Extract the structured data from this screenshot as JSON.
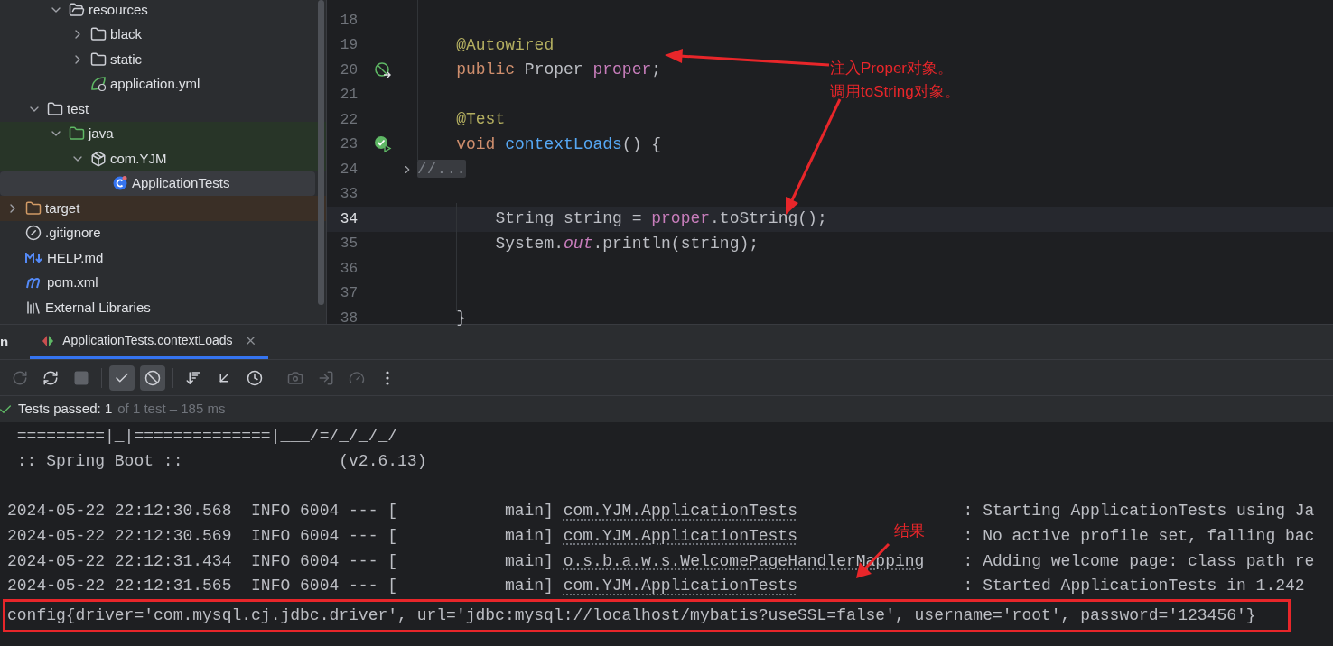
{
  "project_tree": [
    {
      "children": [
        {
          "children": [
            {
              "label": "resources",
              "kind": "resources",
              "expanded": true,
              "selected": false,
              "children": [
                {
                  "label": "black",
                  "kind": "folder",
                  "expanded": false,
                  "selected": false
                },
                {
                  "label": "static",
                  "kind": "folder",
                  "expanded": false,
                  "selected": false
                },
                {
                  "label": "application.yml",
                  "kind": "spring",
                  "selected": false
                }
              ]
            }
          ]
        },
        {
          "label": "test",
          "kind": "folder",
          "expanded": true,
          "selected": false,
          "children": [
            {
              "label": "java",
              "kind": "test-folder",
              "expanded": true,
              "selected": false,
              "children": [
                {
                  "label": "com.YJM",
                  "kind": "test-package",
                  "expanded": true,
                  "selected": false,
                  "children": [
                    {
                      "label": "ApplicationTests",
                      "kind": "test-class",
                      "selected": true
                    }
                  ]
                }
              ]
            }
          ]
        }
      ]
    },
    {
      "label": "target",
      "kind": "excluded-folder",
      "expanded": false,
      "selected": false
    },
    {
      "label": ".gitignore",
      "kind": "ignore",
      "selected": false
    },
    {
      "label": "HELP.md",
      "kind": "markdown",
      "selected": false
    },
    {
      "label": "pom.xml",
      "kind": "maven",
      "selected": false
    },
    {
      "label": "External Libraries",
      "kind": "library",
      "selected": false
    }
  ],
  "editor": {
    "lines": [
      {
        "number": "18",
        "current": false
      },
      {
        "number": "19",
        "current": false,
        "tokens": [
          {
            "text": "    @Autowired",
            "kind": "annotation"
          }
        ]
      },
      {
        "number": "20",
        "current": false,
        "kind": "bean",
        "tokens": [
          {
            "text": "    public ",
            "kind": "keyword"
          },
          {
            "text": "Proper ",
            "kind": "plain"
          },
          {
            "text": "proper",
            "kind": "field"
          },
          {
            "text": ";",
            "kind": "plain"
          }
        ]
      },
      {
        "number": "21",
        "current": false
      },
      {
        "number": "22",
        "current": false,
        "tokens": [
          {
            "text": "    @Test",
            "kind": "annotation"
          }
        ]
      },
      {
        "number": "23",
        "current": false,
        "kind": "run-passed",
        "tokens": [
          {
            "text": "    void ",
            "kind": "keyword"
          },
          {
            "text": "contextLoads",
            "kind": "method"
          },
          {
            "text": "() {",
            "kind": "plain"
          }
        ]
      },
      {
        "number": "24",
        "current": false,
        "kind": "fold",
        "tokens": [
          {
            "text": "//...",
            "kind": "folded"
          }
        ]
      },
      {
        "number": "33",
        "current": false
      },
      {
        "number": "34",
        "current": true,
        "tokens": [
          {
            "text": "        String string = ",
            "kind": "plain"
          },
          {
            "text": "proper",
            "kind": "field"
          },
          {
            "text": ".toString();",
            "kind": "plain"
          }
        ]
      },
      {
        "number": "35",
        "current": false,
        "tokens": [
          {
            "text": "        System.",
            "kind": "plain"
          },
          {
            "text": "out",
            "kind": "static-field"
          },
          {
            "text": ".println(string);",
            "kind": "plain"
          }
        ]
      },
      {
        "number": "36",
        "current": false
      },
      {
        "number": "37",
        "current": false
      },
      {
        "number": "38",
        "current": false,
        "tokens": [
          {
            "text": "    }",
            "kind": "plain"
          }
        ]
      }
    ]
  },
  "run_panel": {
    "tool_window_label": "n",
    "tabs": [
      {
        "label": "ApplicationTests.contextLoads",
        "selected": true
      }
    ],
    "toolbar": [
      {
        "kind": "rerun",
        "on": false,
        "disabled": true
      },
      {
        "kind": "rerun-failed",
        "on": false,
        "disabled": false
      },
      {
        "kind": "stop",
        "on": false,
        "disabled": true
      },
      {
        "kind": "show-passed",
        "on": true,
        "disabled": false
      },
      {
        "kind": "show-ignored",
        "on": true,
        "disabled": false
      },
      {
        "kind": "sort",
        "on": false,
        "disabled": false
      },
      {
        "kind": "collapse",
        "on": false,
        "disabled": false
      },
      {
        "kind": "duration",
        "on": false,
        "disabled": false
      },
      {
        "kind": "screenshot",
        "on": false,
        "disabled": true
      },
      {
        "kind": "import",
        "on": false,
        "disabled": true
      },
      {
        "kind": "profile",
        "on": false,
        "disabled": true
      },
      {
        "kind": "more",
        "on": false,
        "disabled": false
      }
    ],
    "status": {
      "passed": "Tests passed: 1",
      "detail": "of 1 test – 185 ms"
    },
    "console": [
      {
        "kind": "banner",
        "text": " =========|_|==============|___/=/_/_/_/"
      },
      {
        "kind": "banner",
        "text": " :: Spring Boot ::                (v2.6.13)"
      },
      {
        "kind": "blank"
      },
      {
        "kind": "log",
        "prefix": "2024-05-22 22:12:30.568  INFO 6004 --- [           main]",
        "logger": "com.YJM.ApplicationTests",
        "message": ": Starting ApplicationTests using Ja"
      },
      {
        "kind": "log",
        "prefix": "2024-05-22 22:12:30.569  INFO 6004 --- [           main]",
        "logger": "com.YJM.ApplicationTests",
        "message": ": No active profile set, falling bac"
      },
      {
        "kind": "log",
        "prefix": "2024-05-22 22:12:31.434  INFO 6004 --- [           main]",
        "logger": "o.s.b.a.w.s.WelcomePageHandlerMapping",
        "message": ": Adding welcome page: class path re"
      },
      {
        "kind": "log",
        "prefix": "2024-05-22 22:12:31.565  INFO 6004 --- [           main]",
        "logger": "com.YJM.ApplicationTests",
        "message": ": Started ApplicationTests in 1.242"
      },
      {
        "kind": "output",
        "text": "config{driver='com.mysql.cj.jdbc.driver', url='jdbc:mysql://localhost/mybatis?useSSL=false', username='root', password='123456'}"
      }
    ]
  },
  "annotations": [
    {
      "kind": "note",
      "lines": [
        "注入Proper对象。",
        "调用toString对象。"
      ]
    },
    {
      "kind": "result",
      "lines": [
        "结果"
      ]
    }
  ]
}
